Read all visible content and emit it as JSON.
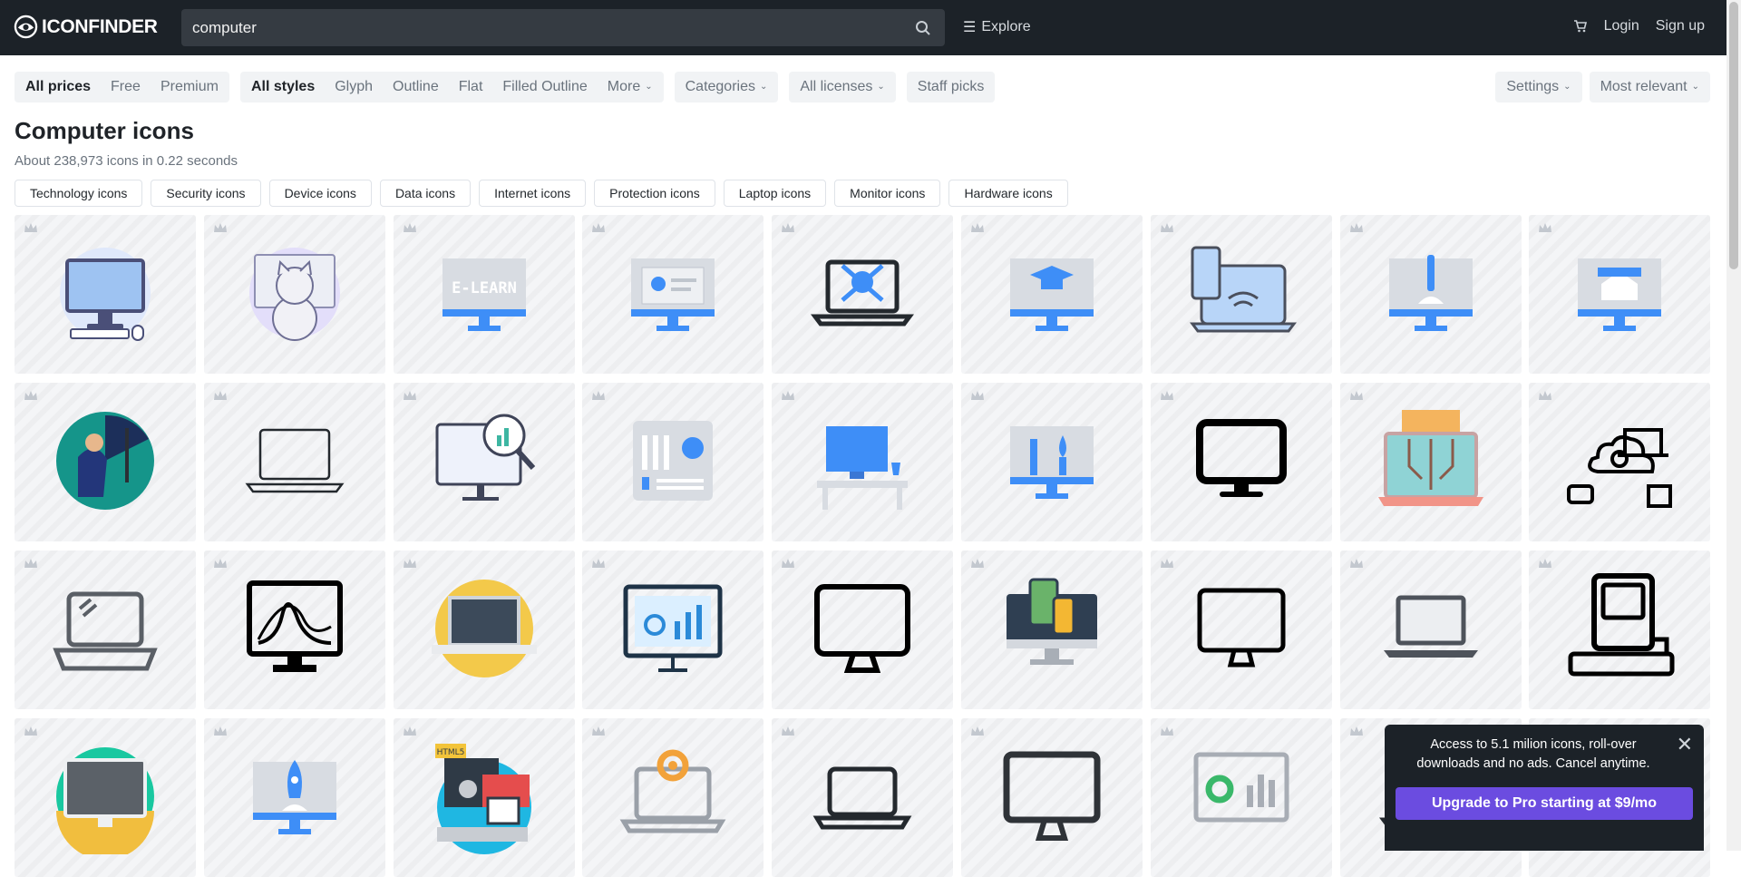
{
  "header": {
    "brand": "ICONFINDER",
    "search_value": "computer",
    "explore_label": "Explore",
    "login_label": "Login",
    "signup_label": "Sign up"
  },
  "filters": {
    "prices": [
      "All prices",
      "Free",
      "Premium"
    ],
    "styles": [
      "All styles",
      "Glyph",
      "Outline",
      "Flat",
      "Filled Outline",
      "More"
    ],
    "categories_label": "Categories",
    "licenses_label": "All licenses",
    "staff_picks_label": "Staff picks",
    "settings_label": "Settings",
    "sort_label": "Most relevant"
  },
  "results": {
    "title": "Computer icons",
    "count_text": "About 238,973 icons in 0.22 seconds"
  },
  "related_tags": [
    "Technology icons",
    "Security icons",
    "Device icons",
    "Data icons",
    "Internet icons",
    "Protection icons",
    "Laptop icons",
    "Monitor icons",
    "Hardware icons"
  ],
  "icons": [
    "desktop-computer-illustration-icon",
    "cat-computer-illustration-icon",
    "e-learn-monitor-icon",
    "certificate-monitor-icon",
    "laptop-skull-icon",
    "graduation-cap-monitor-icon",
    "devices-wifi-icon",
    "monitor-pen-tool-icon",
    "monitor-home-icon",
    "person-at-computer-icon",
    "laptop-outline-icon",
    "monitor-magnifier-chart-icon",
    "motherboard-icon",
    "desk-computer-icon",
    "monitor-design-tools-icon",
    "monitor-glyph-icon",
    "laptop-circuit-icon",
    "cloud-computing-icon",
    "laptop-line-icon",
    "monitor-graph-icon",
    "laptop-circle-icon",
    "monitor-chart-icon",
    "imac-outline-icon",
    "monitor-phone-icon",
    "monitor-outline-icon",
    "laptop-gray-icon",
    "retro-computer-icon",
    "imac-circle-icon",
    "monitor-rocket-icon",
    "html5-computer-icon",
    "laptop-settings-icon",
    "laptop-outline-thin-icon",
    "monitor-outline-thick-icon",
    "monitor-pie-chart-icon",
    "laptop-flat-icon",
    "computer-outline-icon"
  ],
  "promo": {
    "text": "Access to 5.1 milion icons, roll-over downloads and no ads. Cancel anytime.",
    "button_label": "Upgrade to Pro starting at $9/mo"
  },
  "colors": {
    "topbar_bg": "#1c2228",
    "promo_button": "#6b4ce0",
    "icon_blue": "#3e8ef7"
  }
}
